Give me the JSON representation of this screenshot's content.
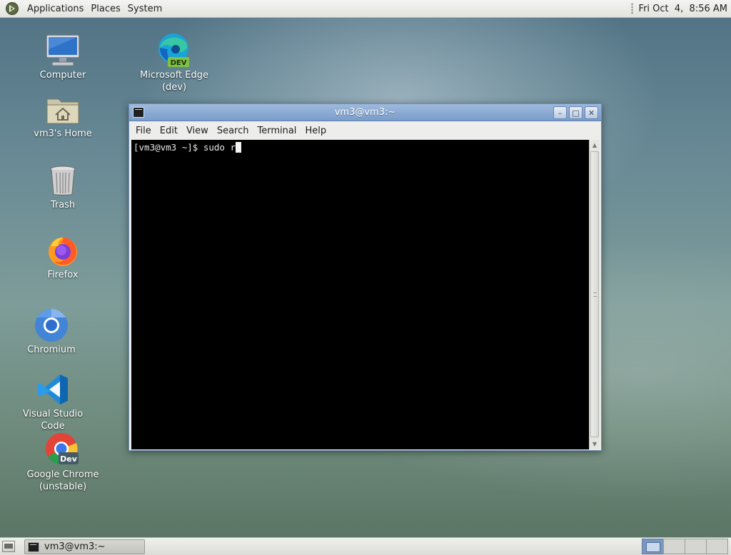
{
  "top_panel": {
    "menus": [
      "Applications",
      "Places",
      "System"
    ],
    "clock": "Fri Oct  4,  8:56 AM",
    "logo_icon": "gnome-foot-icon"
  },
  "desktop_icons": [
    {
      "label": "Computer",
      "icon": "computer-icon"
    },
    {
      "label": "Microsoft Edge (dev)",
      "icon": "edge-dev-icon",
      "badge": "DEV"
    },
    {
      "label": "vm3's Home",
      "icon": "home-folder-icon"
    },
    {
      "label": "Trash",
      "icon": "trash-icon"
    },
    {
      "label": "Firefox",
      "icon": "firefox-icon"
    },
    {
      "label": "Chromium",
      "icon": "chromium-icon"
    },
    {
      "label": "Visual Studio Code",
      "icon": "vscode-icon"
    },
    {
      "label": "Google Chrome",
      "label2": "(unstable)",
      "icon": "chrome-dev-icon",
      "badge": "Dev"
    }
  ],
  "terminal": {
    "title": "vm3@vm3:~",
    "menus": [
      "File",
      "Edit",
      "View",
      "Search",
      "Terminal",
      "Help"
    ],
    "prompt": "[vm3@vm3 ~]$ ",
    "command": "sudo r",
    "buttons": {
      "minimize": "–",
      "maximize": "□",
      "close": "✕"
    }
  },
  "taskbar": {
    "task_label": "vm3@vm3:~"
  },
  "colors": {
    "titlebar": "#7a9dcb",
    "terminal_bg": "#000000",
    "active_workspace": "#7a97bd"
  }
}
